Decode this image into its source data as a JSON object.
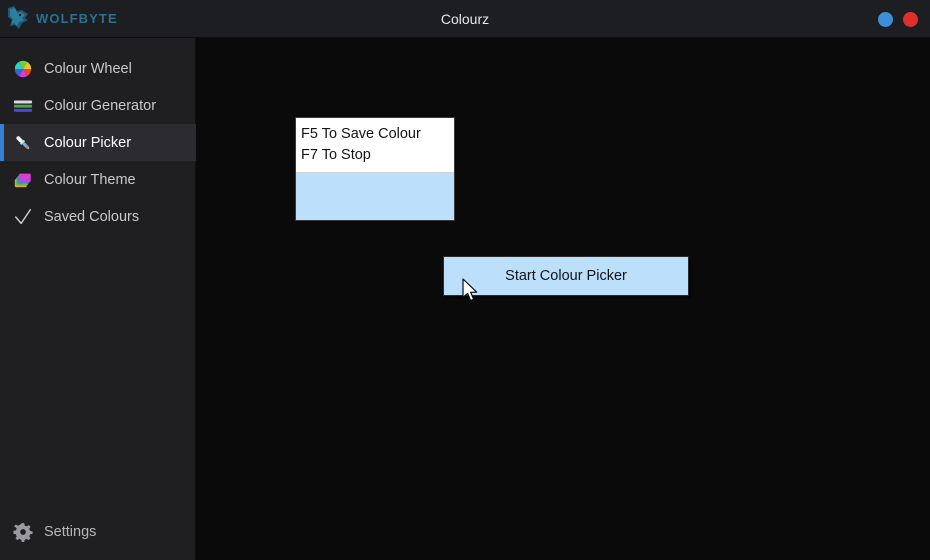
{
  "window": {
    "title": "Colourz",
    "brand_name": "WOLFBYTE",
    "brand_color": "#2d6f8e",
    "brand_icon": "wolf-head-icon",
    "minimize_icon": "minimize-circle-icon",
    "minimize_color": "#3e8fd8",
    "close_icon": "close-circle-icon",
    "close_color": "#e02f2b",
    "titlebar_color": "#1c1e22"
  },
  "sidebar": {
    "background_color": "#1f1f22",
    "active_accent_color": "#3b7fd4",
    "items": [
      {
        "label": "Colour Wheel",
        "icon": "colour-wheel-icon",
        "active": false
      },
      {
        "label": "Colour Generator",
        "icon": "colour-bars-icon",
        "active": false
      },
      {
        "label": "Colour Picker",
        "icon": "eyedropper-icon",
        "active": true
      },
      {
        "label": "Colour Theme",
        "icon": "layered-squares-icon",
        "active": false
      },
      {
        "label": "Saved Colours",
        "icon": "checkmark-icon",
        "active": false
      }
    ],
    "settings": {
      "label": "Settings",
      "icon": "gear-icon"
    }
  },
  "main": {
    "background_color": "#0a0a0a",
    "info_panel": {
      "lines": [
        "F5 To Save Colour",
        "F7 To Stop"
      ],
      "swatch_color": "#bcdffb",
      "panel_background": "#ffffff"
    },
    "start_button": {
      "label": "Start Colour Picker",
      "background_color": "#bcdffb",
      "text_color": "#14161a"
    },
    "cursor": {
      "icon": "mouse-pointer-icon"
    }
  }
}
